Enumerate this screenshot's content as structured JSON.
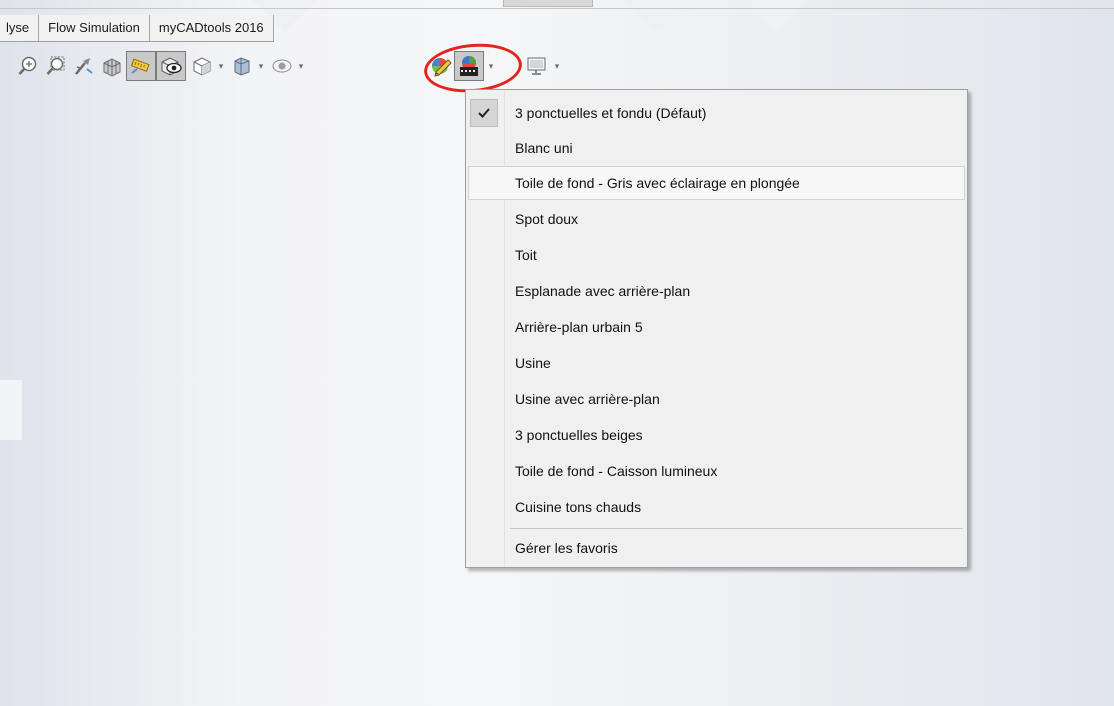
{
  "tabs": [
    "lyse",
    "Flow Simulation",
    "myCADtools 2016"
  ],
  "toolbar": {
    "icons": [
      "zoom-to-fit-icon",
      "zoom-to-area-icon",
      "previous-view-icon",
      "section-view-icon",
      "dynamic-annotation-views-icon",
      "view-orientation-icon",
      "display-style-icon",
      "hide-show-items-icon",
      "edit-appearance-icon",
      "apply-scene-icon",
      "view-settings-icon"
    ]
  },
  "scene_menu": {
    "items": [
      {
        "label": "3 ponctuelles et fondu  (Défaut)",
        "checked": true
      },
      {
        "label": "Blanc uni"
      },
      {
        "label": "Toile de fond - Gris avec éclairage en plongée",
        "highlighted": true
      },
      {
        "label": "Spot doux"
      },
      {
        "label": "Toit"
      },
      {
        "label": "Esplanade avec arrière-plan"
      },
      {
        "label": "Arrière-plan urbain 5"
      },
      {
        "label": "Usine"
      },
      {
        "label": "Usine avec arrière-plan"
      },
      {
        "label": "3 ponctuelles beiges"
      },
      {
        "label": "Toile de fond - Caisson lumineux"
      },
      {
        "label": "Cuisine tons chauds"
      }
    ],
    "footer": "Gérer les favoris"
  },
  "colors": {
    "annotation_circle": "#e2261e",
    "menu_background": "#f0f0f0"
  }
}
